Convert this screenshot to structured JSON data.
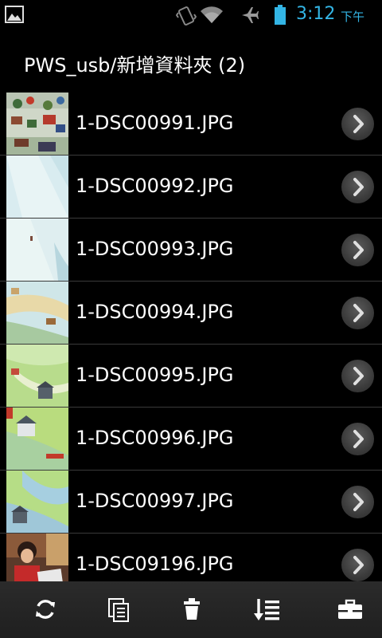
{
  "status_bar": {
    "time": "3:12",
    "ampm": "下午",
    "icons": [
      "gallery-icon",
      "vibrate-icon",
      "wifi-icon",
      "airplane-mode-icon",
      "battery-icon"
    ],
    "accent_color": "#33b5e5"
  },
  "header": {
    "path": "PWS_usb/新增資料夾 (2)"
  },
  "files": [
    {
      "name": "1-DSC00991.JPG"
    },
    {
      "name": "1-DSC00992.JPG"
    },
    {
      "name": "1-DSC00993.JPG"
    },
    {
      "name": "1-DSC00994.JPG"
    },
    {
      "name": "1-DSC00995.JPG"
    },
    {
      "name": "1-DSC00996.JPG"
    },
    {
      "name": "1-DSC00997.JPG"
    },
    {
      "name": "1-DSC09196.JPG"
    }
  ],
  "toolbar": {
    "icons": [
      "refresh-icon",
      "copy-icon",
      "delete-icon",
      "sort-icon",
      "tools-icon"
    ]
  }
}
